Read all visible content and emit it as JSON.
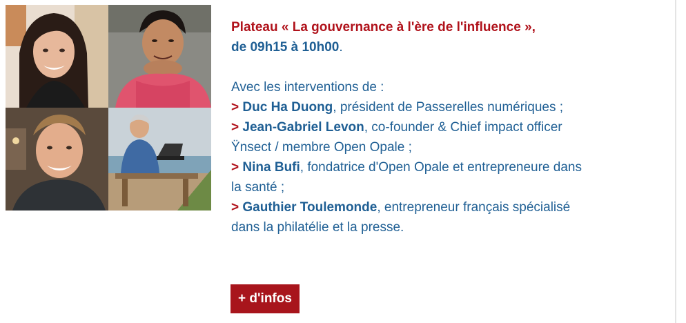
{
  "event": {
    "title": "Plateau « La gouvernance à l'ère de l'influence »,",
    "time": "de 09h15 à 10h00",
    "time_suffix": ".",
    "intro": "Avec les interventions de :"
  },
  "speakers": [
    {
      "marker": ">",
      "name": "Duc Ha Duong",
      "role_lines": [
        ", président de Passerelles numériques ;"
      ]
    },
    {
      "marker": ">",
      "name": "Jean-Gabriel Levon",
      "role_lines": [
        ", co-founder & Chief impact officer",
        "Ÿnsect / membre Open Opale ;"
      ]
    },
    {
      "marker": ">",
      "name": "Nina Bufi",
      "role_lines": [
        ", fondatrice d'Open Opale et entrepreneure dans",
        "la santé ;"
      ]
    },
    {
      "marker": ">",
      "name": "Gauthier Toulemonde",
      "role_lines": [
        ", entrepreneur français spécialisé",
        "dans la philatélie et la presse."
      ]
    }
  ],
  "button": {
    "label": "+ d'infos"
  },
  "colors": {
    "title_red": "#b0121b",
    "text_blue": "#1f5f94",
    "button_red": "#a8151c"
  }
}
